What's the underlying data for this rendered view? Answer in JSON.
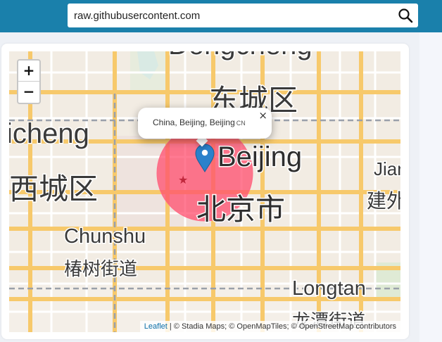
{
  "search": {
    "value": "raw.githubusercontent.com",
    "icon": "search-icon"
  },
  "map": {
    "zoom_in_label": "+",
    "zoom_out_label": "−",
    "labels": {
      "dongcheng_top": "Dongcheng",
      "dongcheng_cn": "东城区",
      "xicheng_partial": "icheng",
      "xicheng_cn": "西城区",
      "beijing_en": "Beijing",
      "beijing_cn": "北京市",
      "jianguo_partial": "Jian",
      "jianguo_cn_partial": "建外",
      "chunshu": "Chunshu",
      "chunshu_cn": "椿树街道",
      "longtan": "Longtan",
      "longtan_cn": "龙潭街道"
    },
    "popup": {
      "text": "China, Beijing, Beijing",
      "country_code": "CN",
      "close": "×"
    },
    "attribution": {
      "leaflet": "Leaflet",
      "sep1": " | © ",
      "stadia": "Stadia Maps",
      "sep2": "; © ",
      "omt": "OpenMapTiles",
      "sep3": "; © ",
      "osm": "OpenStreetMap",
      "suffix": " contributors"
    },
    "colors": {
      "circle": "#ff4d6d",
      "marker": "#2a81cb",
      "road_major": "#f7c96b",
      "background": "#f2ece3"
    }
  }
}
